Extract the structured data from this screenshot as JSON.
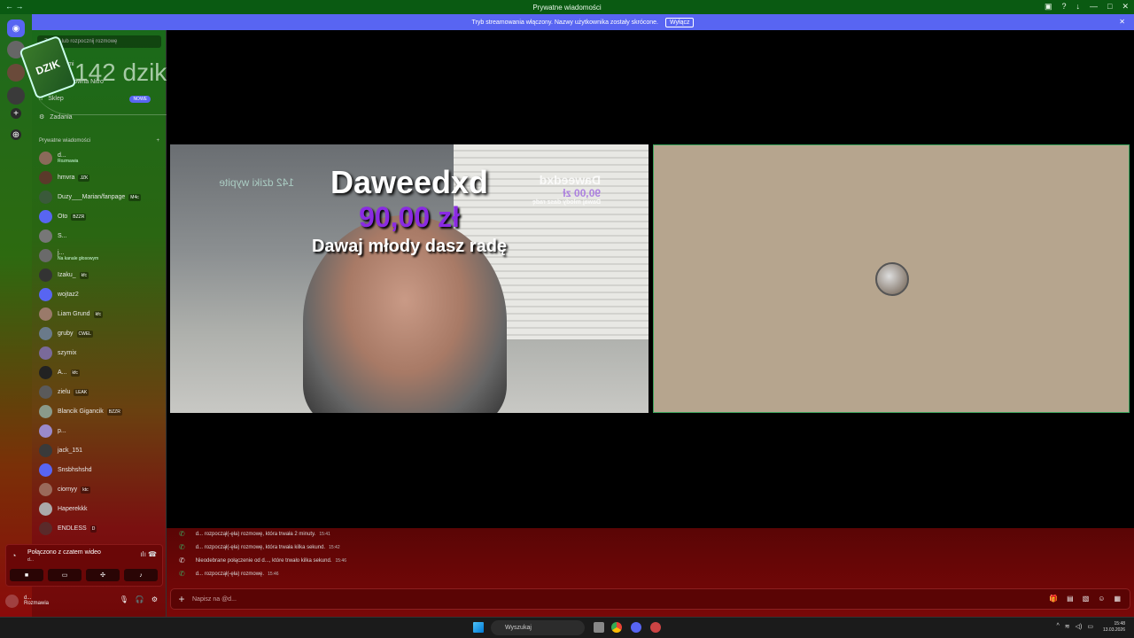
{
  "window": {
    "title": "Prywatne wiadomości"
  },
  "banner": {
    "text": "Tryb streamowania włączony. Nazwy użytkownika zostały skrócone.",
    "button": "Wyłącz"
  },
  "sidebar": {
    "search_placeholder": "Znajdź lub rozpocznij rozmowę",
    "nav": [
      {
        "label": "Znajomi"
      },
      {
        "label": "Strona główna Nitro"
      },
      {
        "label": "Sklep",
        "badge": "NOWE"
      },
      {
        "label": "Zadania"
      }
    ],
    "section_title": "Prywatne wiadomości",
    "section_add": "+",
    "dms": [
      {
        "name": "d...",
        "sub": "Rozmawia",
        "color": "#8a6a5a"
      },
      {
        "name": "hmvra",
        "tag": "JZK",
        "color": "#5a3a2a"
      },
      {
        "name": "Duzy___Marian/fanpage",
        "tag": "M4c",
        "color": "#3a5a3a"
      },
      {
        "name": "Oto",
        "tag": "BZZR",
        "color": "#5865f2"
      },
      {
        "name": "S...",
        "color": "#777"
      },
      {
        "name": "j...",
        "sub": "Na kanale głosowym",
        "color": "#6a6a6a"
      },
      {
        "name": "Izaku_",
        "tag": "kfc",
        "color": "#333"
      },
      {
        "name": "wojtaz2",
        "color": "#5865f2"
      },
      {
        "name": "Liam Grund",
        "tag": "kfc",
        "color": "#9a7a6a"
      },
      {
        "name": "gruby",
        "tag": "CWEL",
        "color": "#6a7a8a"
      },
      {
        "name": "szymix",
        "color": "#7a6a9a"
      },
      {
        "name": "A...",
        "tag": "kfc",
        "color": "#222"
      },
      {
        "name": "zielu",
        "tag": "LEAK",
        "color": "#5a5a5a"
      },
      {
        "name": "Blancik Gigancik",
        "tag": "BZZR",
        "color": "#8a9a8a"
      },
      {
        "name": "p...",
        "color": "#9a8acc"
      },
      {
        "name": "jack_151",
        "color": "#3a3a3a"
      },
      {
        "name": "Snsbhshshd",
        "color": "#5865f2"
      },
      {
        "name": "ciornyy",
        "tag": "ktc",
        "color": "#9a6a5a"
      },
      {
        "name": "Haperekkk",
        "color": "#aaa"
      },
      {
        "name": "ENDLESS",
        "tag": "D",
        "color": "#5a2a2a"
      }
    ]
  },
  "overlay": {
    "counter": "142 dziki wypite",
    "can_label": "DZIK"
  },
  "stream": {
    "donator": "Daweedxd",
    "amount": "90,00 zł",
    "message": "Dawaj młody dasz radę",
    "mirror_name": "Daweedxd",
    "mirror_amount": "90,00 zł",
    "mirror_msg": "Dawaj młody dasz radę",
    "mirror_counter": "142 dziki wypite"
  },
  "voice": {
    "status": "Połączono z czatem wideo",
    "sub": "d..."
  },
  "user": {
    "name": "d...",
    "status": "Rozmawia"
  },
  "chat": {
    "logs": [
      {
        "text": "d... rozpoczął(-ęła) rozmowę, która trwała 2 minuty.",
        "time": "15:41",
        "missed": false
      },
      {
        "text": "d... rozpoczął(-ęła) rozmowę, która trwała kilka sekund.",
        "time": "15:42",
        "missed": false
      },
      {
        "text": "Nieodebrane połączenie od d..., które trwało kilka sekund.",
        "time": "15:46",
        "missed": true
      },
      {
        "text": "d... rozpoczął(-ęła) rozmowę.",
        "time": "15:46",
        "missed": false
      }
    ],
    "placeholder": "Napisz na @d..."
  },
  "taskbar": {
    "search": "Wyszukaj",
    "time": "15:48",
    "date": "13.03.2026"
  }
}
